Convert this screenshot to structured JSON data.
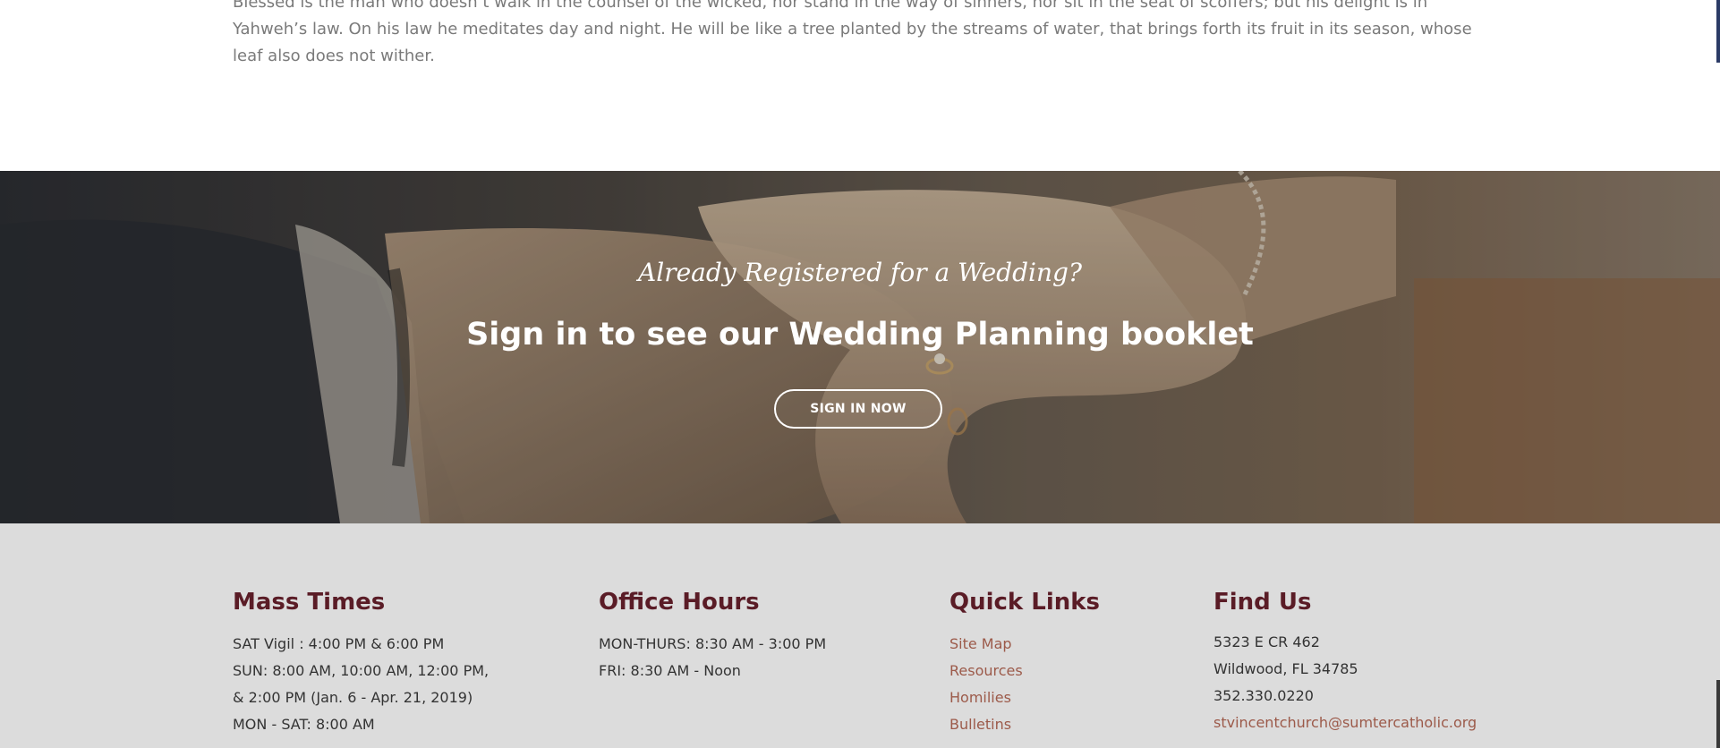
{
  "intro": {
    "text": "Blessed is the man who doesn’t walk in the counsel of the wicked, nor stand in the way of sinners, nor sit in the seat of scoffers; but his delight is in Yahweh’s law. On his law he meditates day and night. He will be like a tree planted by the streams of water, that brings forth its fruit in its season, whose leaf also does not wither."
  },
  "hero": {
    "subtitle": "Already Registered for a Wedding?",
    "title": "Sign in to see our Wedding Planning booklet",
    "button_label": "SIGN IN NOW"
  },
  "footer": {
    "mass_times": {
      "heading": "Mass Times",
      "lines": [
        "SAT Vigil : 4:00 PM & 6:00 PM",
        "SUN: 8:00 AM, 10:00 AM, 12:00 PM,",
        "& 2:00 PM (Jan. 6 - Apr. 21, 2019)",
        "MON - SAT: 8:00 AM"
      ]
    },
    "office_hours": {
      "heading": "Office Hours",
      "lines": [
        "MON-THURS: 8:30 AM - 3:00 PM",
        "FRI: 8:30 AM - Noon"
      ]
    },
    "quick_links": {
      "heading": "Quick Links",
      "items": [
        "Site Map",
        "Resources",
        "Homilies",
        "Bulletins"
      ]
    },
    "find_us": {
      "heading": "Find Us",
      "address_line1": "5323 E CR 462",
      "address_line2": "Wildwood, FL 34785",
      "phone": "352.330.0220",
      "email": "stvincentchurch@sumtercatholic.org"
    }
  },
  "colors": {
    "heading": "#5a1c26",
    "link": "#9c5a4a",
    "footer_bg": "#dcdcdc"
  }
}
